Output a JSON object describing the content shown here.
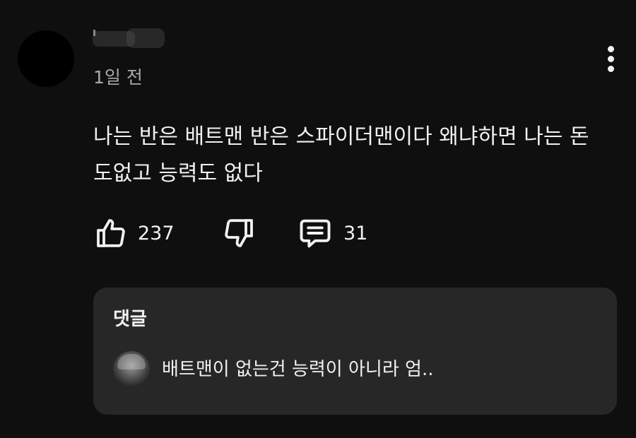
{
  "comment": {
    "author_name": "",
    "timestamp": "1일 전",
    "text": "나는 반은 배트맨 반은 스파이더맨이다 왜냐하면 나는 돈도없고 능력도 없다",
    "like_count": "237",
    "reply_count": "31",
    "icons": {
      "menu": "more-vert-icon",
      "like": "thumbs-up-icon",
      "dislike": "thumbs-down-icon",
      "reply": "comment-icon"
    }
  },
  "replies": {
    "heading": "댓글",
    "preview_text": "배트맨이 없는건 능력이 아니라 엄.."
  },
  "colors": {
    "background": "#0f0f0f",
    "text_primary": "#f1f1f1",
    "text_secondary": "#aaaaaa",
    "card_background": "#272727"
  }
}
